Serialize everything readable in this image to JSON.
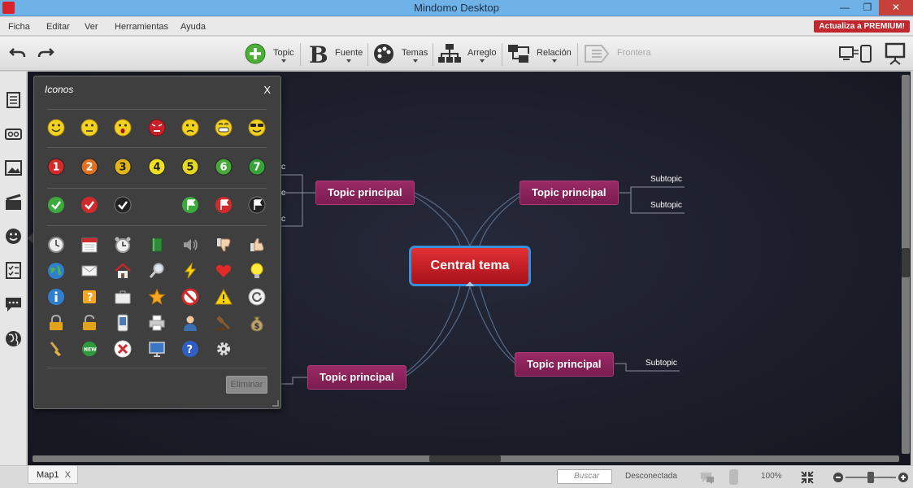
{
  "window": {
    "title": "Mindomo Desktop",
    "min": "—",
    "restore": "❐",
    "close": "✕"
  },
  "menu": [
    "Ficha",
    "Editar",
    "Ver",
    "Herramientas",
    "Ayuda"
  ],
  "premium_label": "Actualiza a PREMIUM!",
  "toolbar": {
    "topic": "Topic",
    "font": "Fuente",
    "themes": "Temas",
    "layout": "Arreglo",
    "relation": "Relación",
    "boundary": "Frontera"
  },
  "icons_panel": {
    "title": "Iconos",
    "close": "X",
    "delete_label": "Eliminar",
    "numbers": [
      "1",
      "2",
      "3",
      "4",
      "5",
      "6",
      "7"
    ],
    "number_colors": [
      "#d32a2a",
      "#e0721f",
      "#e3b418",
      "#f0e021",
      "#e6d81e",
      "#48a93a",
      "#38a23a"
    ],
    "number_text": [
      "#fff",
      "#fff",
      "#222",
      "#222",
      "#222",
      "#fff",
      "#fff"
    ]
  },
  "map": {
    "central": "Central tema",
    "topics": [
      "Topic principal",
      "Topic principal",
      "Topic principal",
      "Topic principal"
    ],
    "subtopic": "Subtopic",
    "left_partial": "c"
  },
  "status": {
    "tab": "Map1",
    "tab_close": "X",
    "search_placeholder": "Buscar",
    "connection": "Desconectada",
    "zoom": "100%"
  }
}
